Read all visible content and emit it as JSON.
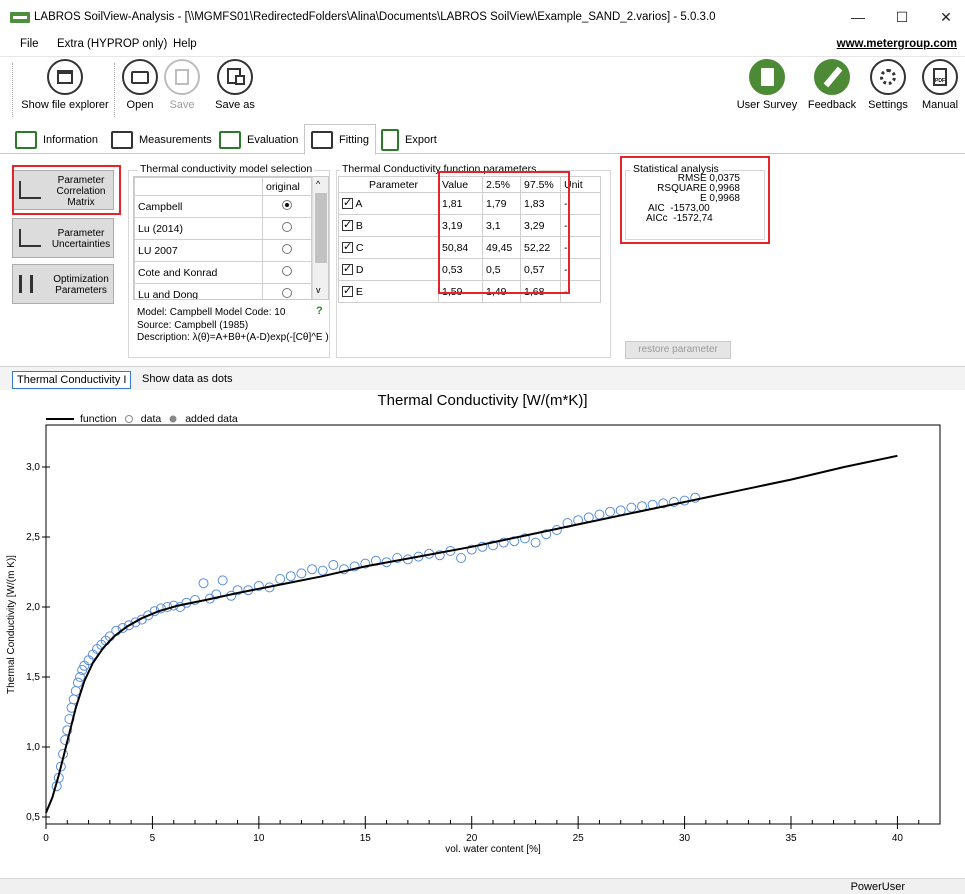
{
  "window": {
    "title": "LABROS SoilView-Analysis - [\\\\MGMFS01\\RedirectedFolders\\Alina\\Documents\\LABROS SoilView\\Example_SAND_2.varios] - 5.0.3.0",
    "minimize": "—",
    "maximize": "☐",
    "close": "✕"
  },
  "menu": {
    "items": [
      "File",
      "Extra (HYPROP only)",
      "Help"
    ],
    "website": "www.metergroup.com"
  },
  "toolbar": {
    "show_file_explorer": "Show file explorer",
    "open": "Open",
    "save": "Save",
    "save_as": "Save as",
    "user_survey": "User Survey",
    "feedback": "Feedback",
    "settings": "Settings",
    "manual": "Manual"
  },
  "tabs": [
    "Information",
    "Measurements",
    "Evaluation",
    "Fitting",
    "Export"
  ],
  "side_buttons": {
    "correlation": "Parameter Correlation Matrix",
    "uncertainties": "Parameter Uncertainties",
    "optimization": "Optimization Parameters"
  },
  "model_selection": {
    "title": "Thermal conductivity model selection",
    "header_original": "original",
    "models": [
      {
        "name": "Campbell",
        "selected": true
      },
      {
        "name": "Lu (2014)",
        "selected": false
      },
      {
        "name": "LU 2007",
        "selected": false
      },
      {
        "name": "Cote and Konrad",
        "selected": false
      },
      {
        "name": "Lu and Dong",
        "selected": false
      }
    ],
    "model_info": "Model: Campbell  Model Code: 10",
    "help": "?",
    "source": "Source: Campbell (1985)",
    "description": "Description: λ(θ)=A+Bθ+(A-D)exp(-[Cθ]^E )"
  },
  "parameters": {
    "title": "Thermal Conductivity function parameters",
    "headers": [
      "Parameter",
      "Value",
      "2.5%",
      "97.5%",
      "Unit"
    ],
    "rows": [
      {
        "name": "A",
        "value": "1,81",
        "low": "1,79",
        "high": "1,83",
        "unit": "-"
      },
      {
        "name": "B",
        "value": "3,19",
        "low": "3,1",
        "high": "3,29",
        "unit": "-"
      },
      {
        "name": "C",
        "value": "50,84",
        "low": "49,45",
        "high": "52,22",
        "unit": "-"
      },
      {
        "name": "D",
        "value": "0,53",
        "low": "0,5",
        "high": "0,57",
        "unit": "-"
      },
      {
        "name": "E",
        "value": "1,59",
        "low": "1,49",
        "high": "1,68",
        "unit": "-"
      }
    ]
  },
  "statistics": {
    "title": "Statistical analysis",
    "rows": [
      {
        "label": "RMSE",
        "value": "0,0375"
      },
      {
        "label": "RSQUARE",
        "value": "0,9968"
      },
      {
        "label": "E",
        "value": "0,9968"
      },
      {
        "label": "AIC",
        "value": "-1573,00"
      },
      {
        "label": "AICc",
        "value": "-1572,74"
      }
    ]
  },
  "restore_button": "restore parameter",
  "chart_tabs": {
    "active": "Thermal Conductivity I",
    "other": "Show data as dots"
  },
  "chart_data": {
    "type": "scatter",
    "title": "Thermal Conductivity [W/(m*K)]",
    "xlabel": "vol. water content [%]",
    "ylabel": "Thermal Conductivity [W/(m K)]",
    "xlim": [
      0,
      42
    ],
    "ylim": [
      0.45,
      3.3
    ],
    "xticks": [
      0,
      5,
      10,
      15,
      20,
      25,
      30,
      35,
      40
    ],
    "yticks": [
      {
        "v": 0.5,
        "label": "0,5"
      },
      {
        "v": 1.0,
        "label": "1,0"
      },
      {
        "v": 1.5,
        "label": "1,5"
      },
      {
        "v": 2.0,
        "label": "2,0"
      },
      {
        "v": 2.5,
        "label": "2,5"
      },
      {
        "v": 3.0,
        "label": "3,0"
      }
    ],
    "legend": [
      "function",
      "data",
      "added data"
    ],
    "series": [
      {
        "name": "function",
        "kind": "line",
        "x": [
          0.0,
          0.3,
          0.6,
          1.0,
          1.4,
          1.8,
          2.2,
          2.7,
          3.2,
          3.8,
          4.5,
          5.3,
          6.2,
          7.5,
          9.0,
          11.0,
          13.0,
          15.0,
          17.5,
          20.0,
          22.5,
          25.0,
          27.5,
          30.0,
          32.5,
          35.0,
          37.5,
          40.0
        ],
        "y": [
          0.53,
          0.64,
          0.8,
          1.04,
          1.28,
          1.47,
          1.6,
          1.71,
          1.79,
          1.86,
          1.92,
          1.97,
          2.01,
          2.05,
          2.1,
          2.16,
          2.22,
          2.29,
          2.36,
          2.43,
          2.51,
          2.59,
          2.67,
          2.75,
          2.83,
          2.91,
          3.0,
          3.08
        ]
      },
      {
        "name": "data",
        "kind": "points",
        "x": [
          0.5,
          0.6,
          0.7,
          0.8,
          0.9,
          1.0,
          1.1,
          1.2,
          1.3,
          1.4,
          1.5,
          1.6,
          1.7,
          1.8,
          2.0,
          2.2,
          2.4,
          2.6,
          2.8,
          3.0,
          3.3,
          3.6,
          3.9,
          4.2,
          4.5,
          4.8,
          5.1,
          5.4,
          5.7,
          6.0,
          6.3,
          6.6,
          7.0,
          7.4,
          7.7,
          8.0,
          8.3,
          8.7,
          9.0,
          9.5,
          10.0,
          10.5,
          11.0,
          11.5,
          12.0,
          12.5,
          13.0,
          13.5,
          14.0,
          14.5,
          15.0,
          15.5,
          16.0,
          16.5,
          17.0,
          17.5,
          18.0,
          18.5,
          19.0,
          19.5,
          20.0,
          20.5,
          21.0,
          21.5,
          22.0,
          22.5,
          23.0,
          23.5,
          24.0,
          24.5,
          25.0,
          25.5,
          26.0,
          26.5,
          27.0,
          27.5,
          28.0,
          28.5,
          29.0,
          29.5,
          30.0,
          30.5
        ],
        "y": [
          0.72,
          0.78,
          0.86,
          0.95,
          1.05,
          1.12,
          1.2,
          1.28,
          1.34,
          1.4,
          1.46,
          1.5,
          1.55,
          1.58,
          1.62,
          1.66,
          1.7,
          1.73,
          1.76,
          1.79,
          1.83,
          1.85,
          1.87,
          1.89,
          1.91,
          1.94,
          1.97,
          1.99,
          2.0,
          2.01,
          2.0,
          2.03,
          2.05,
          2.17,
          2.06,
          2.09,
          2.19,
          2.08,
          2.12,
          2.12,
          2.15,
          2.14,
          2.2,
          2.22,
          2.24,
          2.27,
          2.26,
          2.3,
          2.27,
          2.29,
          2.31,
          2.33,
          2.32,
          2.35,
          2.34,
          2.36,
          2.38,
          2.37,
          2.4,
          2.35,
          2.41,
          2.43,
          2.44,
          2.46,
          2.47,
          2.49,
          2.46,
          2.52,
          2.55,
          2.6,
          2.62,
          2.64,
          2.66,
          2.68,
          2.69,
          2.71,
          2.72,
          2.73,
          2.74,
          2.75,
          2.76,
          2.78
        ]
      }
    ]
  },
  "status": {
    "user": "PowerUser"
  }
}
